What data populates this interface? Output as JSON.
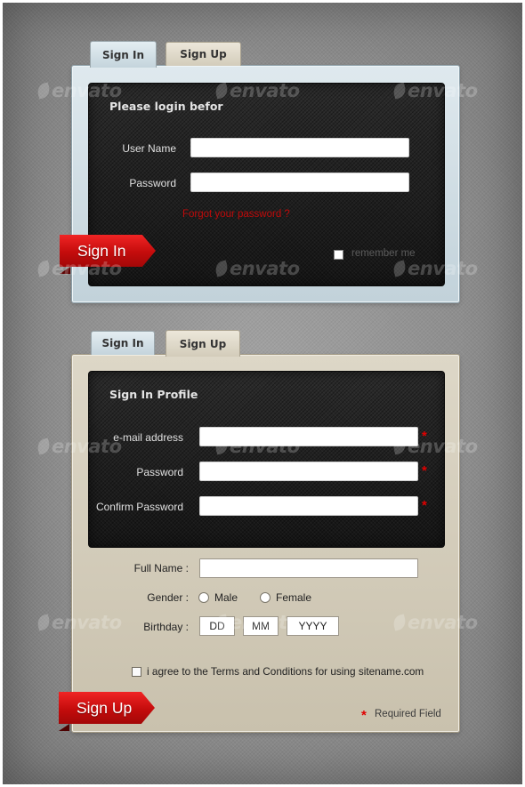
{
  "signin_card": {
    "tabs": [
      "Sign In",
      "Sign Up"
    ],
    "title": "Please login befor",
    "username_label": "User Name",
    "password_label": "Password",
    "forgot_link": "Forgot your password ?",
    "remember_label": "remember me",
    "submit_label": "Sign In"
  },
  "signup_card": {
    "tabs": [
      "Sign In",
      "Sign Up"
    ],
    "title": "Sign In Profile",
    "email_label": "e-mail address",
    "password_label": "Password",
    "confirm_label": "Confirm Password",
    "required_mark": "*",
    "fullname_label": "Full Name :",
    "gender_label": "Gender :",
    "gender_options": [
      "Male",
      "Female"
    ],
    "birthday_label": "Birthday :",
    "birthday_fields": [
      "DD",
      "MM",
      "YYYY"
    ],
    "terms_label": "i agree to the Terms and Conditions for using sitename.com",
    "required_note": "Required Field",
    "submit_label": "Sign Up"
  },
  "watermark": {
    "brand": "envato"
  },
  "colors": {
    "accent_red": "#d01010",
    "dark_panel": "#1e1e1e",
    "blue_panel": "#cddbe1",
    "beige_panel": "#d6cfbd"
  }
}
